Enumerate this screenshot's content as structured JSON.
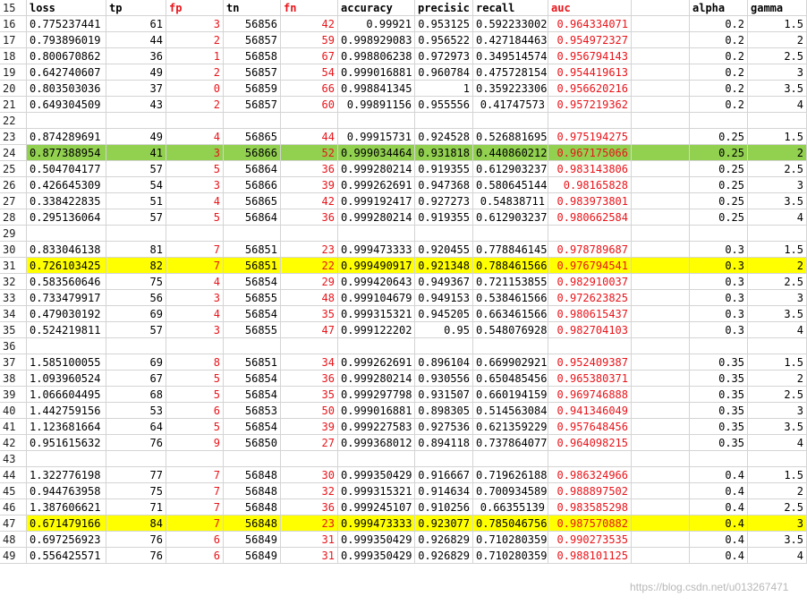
{
  "colors": {
    "red_text": "#e8141a",
    "green_highlight": "#92d050",
    "yellow_highlight": "#ffff00"
  },
  "header": {
    "row_number": "15",
    "cols": [
      "loss",
      "tp",
      "fp",
      "tn",
      "fn",
      "accuracy",
      "precisic",
      "recall",
      "auc",
      "",
      "alpha",
      "gamma"
    ]
  },
  "rows": [
    {
      "n": "16",
      "v": [
        "0.775237441",
        "61",
        "3",
        "56856",
        "42",
        "0.99921",
        "0.953125",
        "0.592233002",
        "0.964334071",
        "",
        "0.2",
        "1.5"
      ]
    },
    {
      "n": "17",
      "v": [
        "0.793896019",
        "44",
        "2",
        "56857",
        "59",
        "0.998929083",
        "0.956522",
        "0.427184463",
        "0.954972327",
        "",
        "0.2",
        "2"
      ]
    },
    {
      "n": "18",
      "v": [
        "0.800670862",
        "36",
        "1",
        "56858",
        "67",
        "0.998806238",
        "0.972973",
        "0.349514574",
        "0.956794143",
        "",
        "0.2",
        "2.5"
      ]
    },
    {
      "n": "19",
      "v": [
        "0.642740607",
        "49",
        "2",
        "56857",
        "54",
        "0.999016881",
        "0.960784",
        "0.475728154",
        "0.954419613",
        "",
        "0.2",
        "3"
      ]
    },
    {
      "n": "20",
      "v": [
        "0.803503036",
        "37",
        "0",
        "56859",
        "66",
        "0.998841345",
        "1",
        "0.359223306",
        "0.956620216",
        "",
        "0.2",
        "3.5"
      ]
    },
    {
      "n": "21",
      "v": [
        "0.649304509",
        "43",
        "2",
        "56857",
        "60",
        "0.99891156",
        "0.955556",
        "0.41747573",
        "0.957219362",
        "",
        "0.2",
        "4"
      ]
    },
    {
      "n": "22",
      "v": [
        "",
        "",
        "",
        "",
        "",
        "",
        "",
        "",
        "",
        "",
        "",
        ""
      ]
    },
    {
      "n": "23",
      "v": [
        "0.874289691",
        "49",
        "4",
        "56865",
        "44",
        "0.99915731",
        "0.924528",
        "0.526881695",
        "0.975194275",
        "",
        "0.25",
        "1.5"
      ]
    },
    {
      "n": "24",
      "hl": "green",
      "v": [
        "0.877388954",
        "41",
        "3",
        "56866",
        "52",
        "0.999034464",
        "0.931818",
        "0.440860212",
        "0.967175066",
        "",
        "0.25",
        "2"
      ]
    },
    {
      "n": "25",
      "v": [
        "0.504704177",
        "57",
        "5",
        "56864",
        "36",
        "0.999280214",
        "0.919355",
        "0.612903237",
        "0.983143806",
        "",
        "0.25",
        "2.5"
      ]
    },
    {
      "n": "26",
      "v": [
        "0.426645309",
        "54",
        "3",
        "56866",
        "39",
        "0.999262691",
        "0.947368",
        "0.580645144",
        "0.98165828",
        "",
        "0.25",
        "3"
      ]
    },
    {
      "n": "27",
      "v": [
        "0.338422835",
        "51",
        "4",
        "56865",
        "42",
        "0.999192417",
        "0.927273",
        "0.54838711",
        "0.983973801",
        "",
        "0.25",
        "3.5"
      ]
    },
    {
      "n": "28",
      "v": [
        "0.295136064",
        "57",
        "5",
        "56864",
        "36",
        "0.999280214",
        "0.919355",
        "0.612903237",
        "0.980662584",
        "",
        "0.25",
        "4"
      ]
    },
    {
      "n": "29",
      "v": [
        "",
        "",
        "",
        "",
        "",
        "",
        "",
        "",
        "",
        "",
        "",
        ""
      ]
    },
    {
      "n": "30",
      "v": [
        "0.833046138",
        "81",
        "7",
        "56851",
        "23",
        "0.999473333",
        "0.920455",
        "0.778846145",
        "0.978789687",
        "",
        "0.3",
        "1.5"
      ]
    },
    {
      "n": "31",
      "hl": "yellow",
      "v": [
        "0.726103425",
        "82",
        "7",
        "56851",
        "22",
        "0.999490917",
        "0.921348",
        "0.788461566",
        "0.976794541",
        "",
        "0.3",
        "2"
      ]
    },
    {
      "n": "32",
      "v": [
        "0.583560646",
        "75",
        "4",
        "56854",
        "29",
        "0.999420643",
        "0.949367",
        "0.721153855",
        "0.982910037",
        "",
        "0.3",
        "2.5"
      ]
    },
    {
      "n": "33",
      "v": [
        "0.733479917",
        "56",
        "3",
        "56855",
        "48",
        "0.999104679",
        "0.949153",
        "0.538461566",
        "0.972623825",
        "",
        "0.3",
        "3"
      ]
    },
    {
      "n": "34",
      "v": [
        "0.479030192",
        "69",
        "4",
        "56854",
        "35",
        "0.999315321",
        "0.945205",
        "0.663461566",
        "0.980615437",
        "",
        "0.3",
        "3.5"
      ]
    },
    {
      "n": "35",
      "v": [
        "0.524219811",
        "57",
        "3",
        "56855",
        "47",
        "0.999122202",
        "0.95",
        "0.548076928",
        "0.982704103",
        "",
        "0.3",
        "4"
      ]
    },
    {
      "n": "36",
      "v": [
        "",
        "",
        "",
        "",
        "",
        "",
        "",
        "",
        "",
        "",
        "",
        ""
      ]
    },
    {
      "n": "37",
      "v": [
        "1.585100055",
        "69",
        "8",
        "56851",
        "34",
        "0.999262691",
        "0.896104",
        "0.669902921",
        "0.952409387",
        "",
        "0.35",
        "1.5"
      ]
    },
    {
      "n": "38",
      "v": [
        "1.093960524",
        "67",
        "5",
        "56854",
        "36",
        "0.999280214",
        "0.930556",
        "0.650485456",
        "0.965380371",
        "",
        "0.35",
        "2"
      ]
    },
    {
      "n": "39",
      "v": [
        "1.066604495",
        "68",
        "5",
        "56854",
        "35",
        "0.999297798",
        "0.931507",
        "0.660194159",
        "0.969746888",
        "",
        "0.35",
        "2.5"
      ]
    },
    {
      "n": "40",
      "v": [
        "1.442759156",
        "53",
        "6",
        "56853",
        "50",
        "0.999016881",
        "0.898305",
        "0.514563084",
        "0.941346049",
        "",
        "0.35",
        "3"
      ]
    },
    {
      "n": "41",
      "v": [
        "1.123681664",
        "64",
        "5",
        "56854",
        "39",
        "0.999227583",
        "0.927536",
        "0.621359229",
        "0.957648456",
        "",
        "0.35",
        "3.5"
      ]
    },
    {
      "n": "42",
      "v": [
        "0.951615632",
        "76",
        "9",
        "56850",
        "27",
        "0.999368012",
        "0.894118",
        "0.737864077",
        "0.964098215",
        "",
        "0.35",
        "4"
      ]
    },
    {
      "n": "43",
      "v": [
        "",
        "",
        "",
        "",
        "",
        "",
        "",
        "",
        "",
        "",
        "",
        ""
      ]
    },
    {
      "n": "44",
      "v": [
        "1.322776198",
        "77",
        "7",
        "56848",
        "30",
        "0.999350429",
        "0.916667",
        "0.719626188",
        "0.986324966",
        "",
        "0.4",
        "1.5"
      ]
    },
    {
      "n": "45",
      "v": [
        "0.944763958",
        "75",
        "7",
        "56848",
        "32",
        "0.999315321",
        "0.914634",
        "0.700934589",
        "0.988897502",
        "",
        "0.4",
        "2"
      ]
    },
    {
      "n": "46",
      "v": [
        "1.387606621",
        "71",
        "7",
        "56848",
        "36",
        "0.999245107",
        "0.910256",
        "0.66355139",
        "0.983585298",
        "",
        "0.4",
        "2.5"
      ]
    },
    {
      "n": "47",
      "hl": "yellow",
      "v": [
        "0.671479166",
        "84",
        "7",
        "56848",
        "23",
        "0.999473333",
        "0.923077",
        "0.785046756",
        "0.987570882",
        "",
        "0.4",
        "3"
      ]
    },
    {
      "n": "48",
      "v": [
        "0.697256923",
        "76",
        "6",
        "56849",
        "31",
        "0.999350429",
        "0.926829",
        "0.710280359",
        "0.990273535",
        "",
        "0.4",
        "3.5"
      ]
    },
    {
      "n": "49",
      "v": [
        "0.556425571",
        "76",
        "6",
        "56849",
        "31",
        "0.999350429",
        "0.926829",
        "0.710280359",
        "0.988101125",
        "",
        "0.4",
        "4"
      ]
    }
  ],
  "watermark": "https://blog.csdn.net/u013267471"
}
